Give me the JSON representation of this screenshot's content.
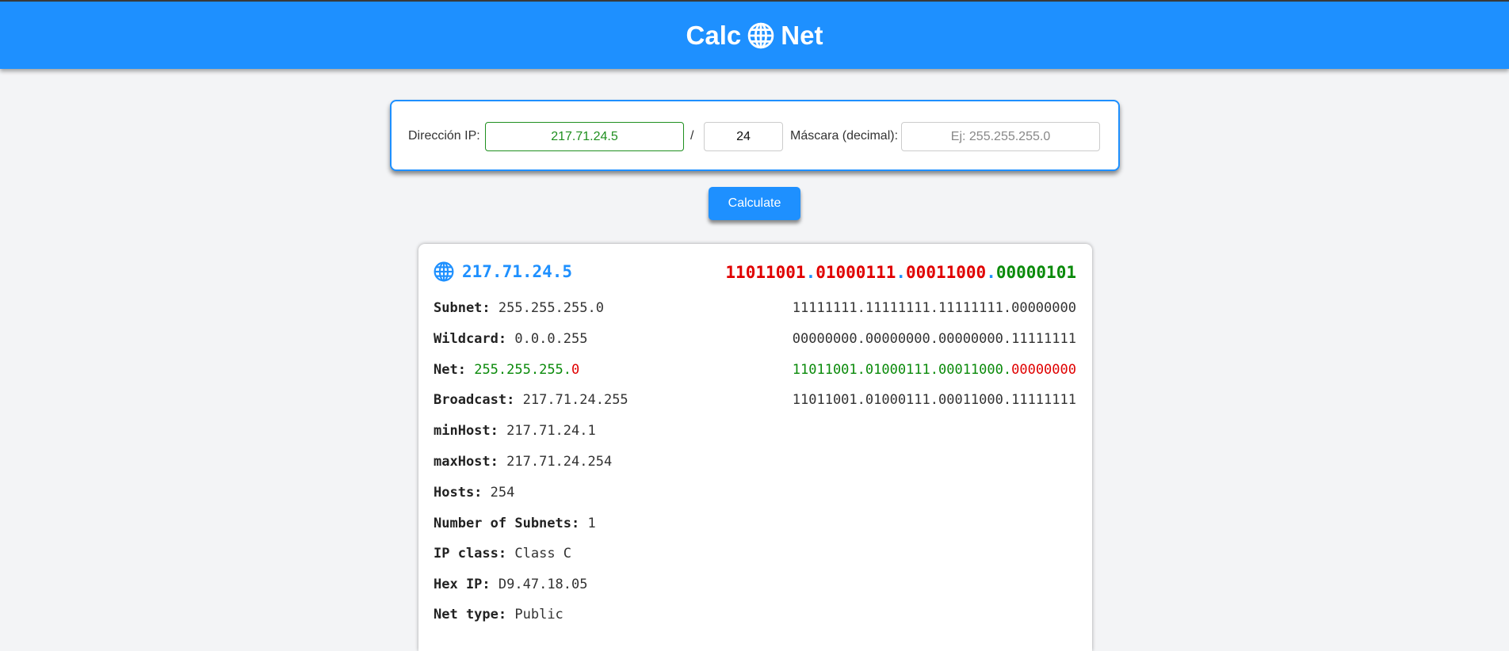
{
  "header": {
    "title_left": "Calc",
    "title_right": "Net",
    "logo_icon": "globe-icon"
  },
  "form": {
    "ip_label": "Dirección IP:",
    "ip_value": "217.71.24.5",
    "slash": "/",
    "prefix_value": "24",
    "mask_label": "Máscara (decimal):",
    "mask_placeholder": "Ej: 255.255.255.0",
    "calculate_label": "Calculate"
  },
  "result": {
    "ip": "217.71.24.5",
    "ip_binary": {
      "o1": "11011001",
      "o2": "01000111",
      "o3": "00011000",
      "o4": "00000101",
      "dot": "."
    },
    "rows": {
      "subnet": {
        "label": "Subnet:",
        "value": "255.255.255.0",
        "binary": "11111111.11111111.11111111.00000000"
      },
      "wildcard": {
        "label": "Wildcard:",
        "value": "0.0.0.255",
        "binary": "00000000.00000000.00000000.11111111"
      },
      "net": {
        "label": "Net:",
        "value_network": "255.255.255.",
        "value_host": "0",
        "binary_network": "11011001.01000111.00011000.",
        "binary_host": "00000000",
        "dot": "."
      },
      "broadcast": {
        "label": "Broadcast:",
        "value": "217.71.24.255",
        "binary": "11011001.01000111.00011000.11111111"
      },
      "minhost": {
        "label": "minHost:",
        "value": "217.71.24.1"
      },
      "maxhost": {
        "label": "maxHost:",
        "value": "217.71.24.254"
      },
      "hosts": {
        "label": "Hosts:",
        "value": "254"
      },
      "subnets": {
        "label": "Number of Subnets:",
        "value": "1"
      },
      "ipclass": {
        "label": "IP class:",
        "value": "Class C"
      },
      "hexip": {
        "label": "Hex IP:",
        "value": "D9.47.18.05"
      },
      "nettype": {
        "label": "Net type:",
        "value": "Public"
      }
    }
  },
  "colors": {
    "accent": "#1e90ff",
    "network_bits": "#0a8a0a",
    "host_bits": "#e00000"
  }
}
